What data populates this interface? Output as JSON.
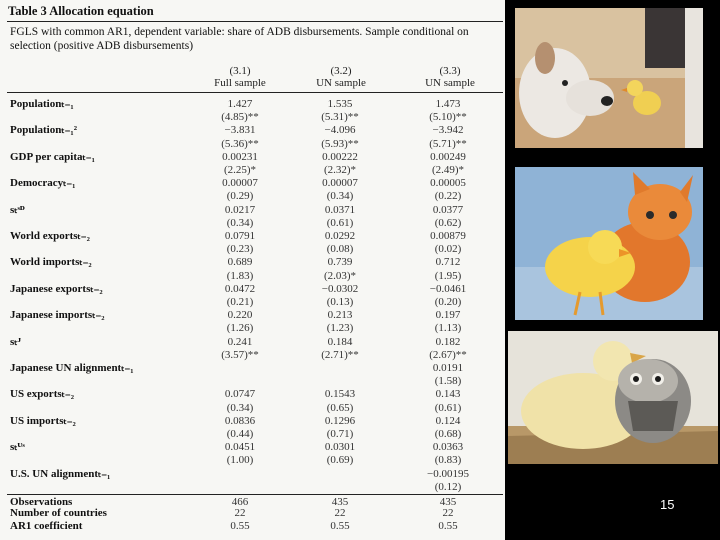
{
  "table": {
    "title": "Table 3  Allocation equation",
    "note_line1": "FGLS with common AR1, dependent variable: share of ADB disbursements. Sample conditional on",
    "note_line2": "selection (positive ADB disbursements)",
    "columns": [
      {
        "num": "(3.1)",
        "name": "Full sample"
      },
      {
        "num": "(3.2)",
        "name": "UN sample"
      },
      {
        "num": "(3.3)",
        "name": "UN sample"
      }
    ],
    "rows": [
      {
        "label": "Populationₜ₋₁",
        "v": [
          "1.427",
          "1.535",
          "1.473"
        ]
      },
      {
        "label": "",
        "v": [
          "(4.85)**",
          "(5.31)**",
          "(5.10)**"
        ]
      },
      {
        "label": "Populationₜ₋₁²",
        "v": [
          "−3.831",
          "−4.096",
          "−3.942"
        ]
      },
      {
        "label": "",
        "v": [
          "(5.36)**",
          "(5.93)**",
          "(5.71)**"
        ]
      },
      {
        "label": "GDP per capitaₜ₋₁",
        "v": [
          "0.00231",
          "0.00222",
          "0.00249"
        ]
      },
      {
        "label": "",
        "v": [
          "(2.25)*",
          "(2.32)*",
          "(2.49)*"
        ]
      },
      {
        "label": "Democracyₜ₋₁",
        "v": [
          "0.00007",
          "0.00007",
          "0.00005"
        ]
      },
      {
        "label": "",
        "v": [
          "(0.29)",
          "(0.34)",
          "(0.22)"
        ]
      },
      {
        "label": "sₜˢᴰ",
        "v": [
          "0.0217",
          "0.0371",
          "0.0377"
        ]
      },
      {
        "label": "",
        "v": [
          "(0.34)",
          "(0.61)",
          "(0.62)"
        ]
      },
      {
        "label": "World exportsₜ₋₂",
        "v": [
          "0.0791",
          "0.0292",
          "0.00879"
        ]
      },
      {
        "label": "",
        "v": [
          "(0.23)",
          "(0.08)",
          "(0.02)"
        ]
      },
      {
        "label": "World importsₜ₋₂",
        "v": [
          "0.689",
          "0.739",
          "0.712"
        ]
      },
      {
        "label": "",
        "v": [
          "(1.83)",
          "(2.03)*",
          "(1.95)"
        ]
      },
      {
        "label": "Japanese exportsₜ₋₂",
        "v": [
          "0.0472",
          "−0.0302",
          "−0.0461"
        ]
      },
      {
        "label": "",
        "v": [
          "(0.21)",
          "(0.13)",
          "(0.20)"
        ]
      },
      {
        "label": "Japanese importsₜ₋₂",
        "v": [
          "0.220",
          "0.213",
          "0.197"
        ]
      },
      {
        "label": "",
        "v": [
          "(1.26)",
          "(1.23)",
          "(1.13)"
        ]
      },
      {
        "label": "sₜᴶ",
        "v": [
          "0.241",
          "0.184",
          "0.182"
        ]
      },
      {
        "label": "",
        "v": [
          "(3.57)**",
          "(2.71)**",
          "(2.67)**"
        ]
      },
      {
        "label": "Japanese UN alignmentₜ₋₁",
        "v": [
          "",
          "",
          "0.0191"
        ]
      },
      {
        "label": "",
        "v": [
          "",
          "",
          "(1.58)"
        ]
      },
      {
        "label": "US exportsₜ₋₂",
        "v": [
          "0.0747",
          "0.1543",
          "0.143"
        ]
      },
      {
        "label": "",
        "v": [
          "(0.34)",
          "(0.65)",
          "(0.61)"
        ]
      },
      {
        "label": "US importsₜ₋₂",
        "v": [
          "0.0836",
          "0.1296",
          "0.124"
        ]
      },
      {
        "label": "",
        "v": [
          "(0.44)",
          "(0.71)",
          "(0.68)"
        ]
      },
      {
        "label": "sₜᵁˢ",
        "v": [
          "0.0451",
          "0.0301",
          "0.0363"
        ]
      },
      {
        "label": "",
        "v": [
          "(1.00)",
          "(0.69)",
          "(0.83)"
        ]
      },
      {
        "label": "U.S. UN alignmentₜ₋₁",
        "v": [
          "",
          "",
          "−0.00195"
        ]
      },
      {
        "label": "",
        "v": [
          "",
          "",
          "(0.12)"
        ]
      },
      {
        "label": "Observations",
        "v": [
          "466",
          "435",
          "435"
        ]
      },
      {
        "label": "Number of countries",
        "v": [
          "22",
          "22",
          "22"
        ]
      },
      {
        "label": "AR1 coefficient",
        "v": [
          "0.55",
          "0.55",
          "0.55"
        ]
      }
    ]
  },
  "page_number": "15",
  "images": [
    "dog-and-duckling",
    "kitten-and-duckling",
    "duckling-and-owl"
  ]
}
